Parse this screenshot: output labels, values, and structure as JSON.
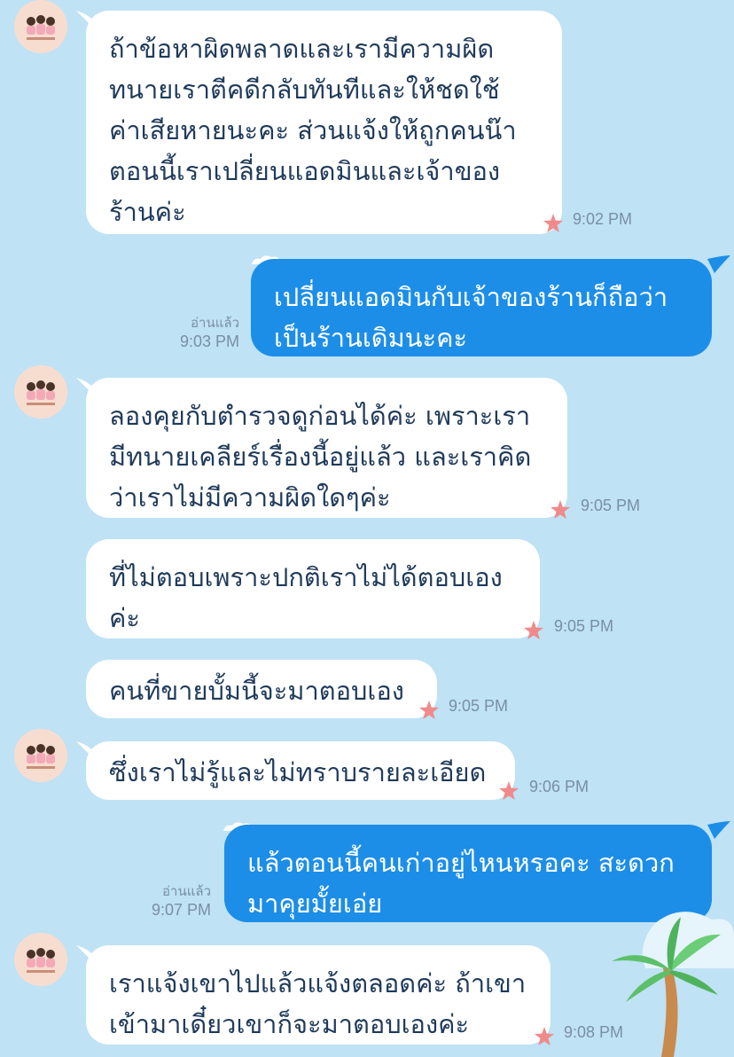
{
  "messages": [
    {
      "id": "m1",
      "direction": "incoming",
      "text": "ถ้าข้อหาผิดพลาดและเรามีความผิด\nทนายเราตีคดีกลับทันทีและให้ชดใช้\nค่าเสียหายนะคะ ส่วนแจ้งให้ถูกคนน๊า\nตอนนี้เราเปลี่ยนแอดมินและเจ้าของ\nร้านค่ะ",
      "time": "9:02 PM"
    },
    {
      "id": "m2",
      "direction": "outgoing",
      "text": "เปลี่ยนแอดมินกับเจ้าของร้านก็ถือว่า\nเป็นร้านเดิมนะคะ",
      "read_label": "อ่านแล้ว",
      "time": "9:03 PM"
    },
    {
      "id": "m3",
      "direction": "incoming",
      "text": "ลองคุยกับตำรวจดูก่อนได้ค่ะ เพราะเรา\nมีทนายเคลียร์เรื่องนี้อยู่แล้ว และเราคิด\nว่าเราไม่มีความผิดใดๆค่ะ",
      "time": "9:05 PM"
    },
    {
      "id": "m4",
      "direction": "incoming",
      "text": "ที่ไม่ตอบเพราะปกติเราไม่ได้ตอบเอง\nค่ะ",
      "time": "9:05 PM"
    },
    {
      "id": "m5",
      "direction": "incoming",
      "text": "คนที่ขายบั้มนี้จะมาตอบเอง",
      "time": "9:05 PM"
    },
    {
      "id": "m6",
      "direction": "incoming",
      "text": "ซึ่งเราไม่รู้และไม่ทราบรายละเอียด",
      "time": "9:06 PM"
    },
    {
      "id": "m7",
      "direction": "outgoing",
      "text": "แล้วตอนนี้คนเก่าอยู่ไหนหรอคะ สะดวก\nมาคุยมั้ยเอ่ย",
      "read_label": "อ่านแล้ว",
      "time": "9:07 PM"
    },
    {
      "id": "m8",
      "direction": "incoming",
      "text": "เราแจ้งเขาไปแล้วแจ้งตลอดค่ะ ถ้าเขา\nเข้ามาเดี๋ยวเขาก็จะมาตอบเองค่ะ",
      "time": "9:08 PM"
    }
  ],
  "colors": {
    "background": "#bfe2f5",
    "incoming_bubble": "#ffffff",
    "incoming_text": "#1f3a5a",
    "outgoing_bubble": "#1c8ee8",
    "outgoing_text": "#ffffff",
    "meta_text": "#7a8ea3",
    "star": "#f08a8a"
  },
  "icons": {
    "avatar": "shop-avatar-icon",
    "time_marker": "starfish-icon",
    "bubble_decoration": "cloud-icon",
    "corner_decoration": "palm-tree-icon"
  }
}
